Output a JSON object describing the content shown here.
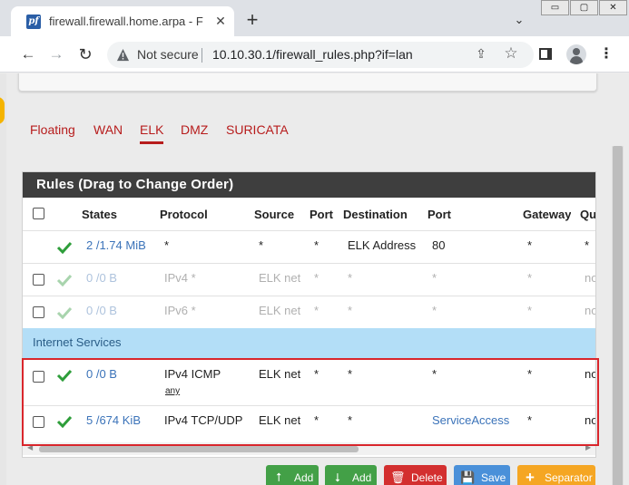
{
  "browser": {
    "tab_title": "firewall.firewall.home.arpa - Firew",
    "favicon_text": "pf",
    "tab_close": "✕",
    "new_tab": "+",
    "tab_list": "⌄",
    "win_controls": [
      "▭",
      "▢",
      "✕"
    ],
    "not_secure": "Not secure",
    "url": "10.10.30.1/firewall_rules.php?if=lan",
    "back": "←",
    "forward": "→",
    "reload": "↻",
    "menu": "⋮",
    "share": "⇪",
    "star": "☆"
  },
  "interface_tabs": [
    "Floating",
    "WAN",
    "ELK",
    "DMZ",
    "SURICATA"
  ],
  "active_tab": "ELK",
  "panel": {
    "title": "Rules (Drag to Change Order)"
  },
  "table": {
    "columns": [
      "States",
      "Protocol",
      "Source",
      "Port",
      "Destination",
      "Port",
      "Gateway",
      "Qu"
    ],
    "rows": [
      {
        "states": "2 /1.74 MiB",
        "protocol": "*",
        "source": "*",
        "src_port": "*",
        "destination": "ELK Address",
        "dst_port": "80",
        "gateway": "*",
        "queue": "*",
        "checkbox": false,
        "disabled": false
      },
      {
        "states": "0 /0 B",
        "protocol": "IPv4 *",
        "source": "ELK net",
        "src_port": "*",
        "destination": "*",
        "dst_port": "*",
        "gateway": "*",
        "queue": "no",
        "checkbox": true,
        "disabled": true
      },
      {
        "states": "0 /0 B",
        "protocol": "IPv6 *",
        "source": "ELK net",
        "src_port": "*",
        "destination": "*",
        "dst_port": "*",
        "gateway": "*",
        "queue": "no",
        "checkbox": true,
        "disabled": true
      }
    ],
    "separator": "Internet Services",
    "rows_after": [
      {
        "states": "0 /0 B",
        "protocol": "IPv4 ICMP",
        "protocol_sub": "any",
        "source": "ELK net",
        "src_port": "*",
        "destination": "*",
        "dst_port": "*",
        "gateway": "*",
        "queue": "no",
        "checkbox": true,
        "disabled": false
      },
      {
        "states": "5 /674 KiB",
        "protocol": "IPv4 TCP/UDP",
        "source": "ELK net",
        "src_port": "*",
        "destination": "*",
        "dst_port": "ServiceAccess",
        "gateway": "*",
        "queue": "no",
        "checkbox": true,
        "disabled": false
      }
    ]
  },
  "actions": [
    {
      "label": "Add",
      "icon": "arrow-up-icon",
      "glyph": "⭡"
    },
    {
      "label": "Add",
      "icon": "arrow-down-icon",
      "glyph": "⭣"
    },
    {
      "label": "Delete",
      "icon": "trash-icon",
      "glyph": "🗑"
    },
    {
      "label": "Save",
      "icon": "save-icon",
      "glyph": "💾"
    },
    {
      "label": "Separator",
      "icon": "plus-icon",
      "glyph": "+"
    }
  ],
  "colors": {
    "accent_red": "#b71c1c",
    "check_green": "#2e9e3a",
    "link_blue": "#3b73b9",
    "separator_bg": "#b3def7",
    "highlight": "#d9262c"
  }
}
